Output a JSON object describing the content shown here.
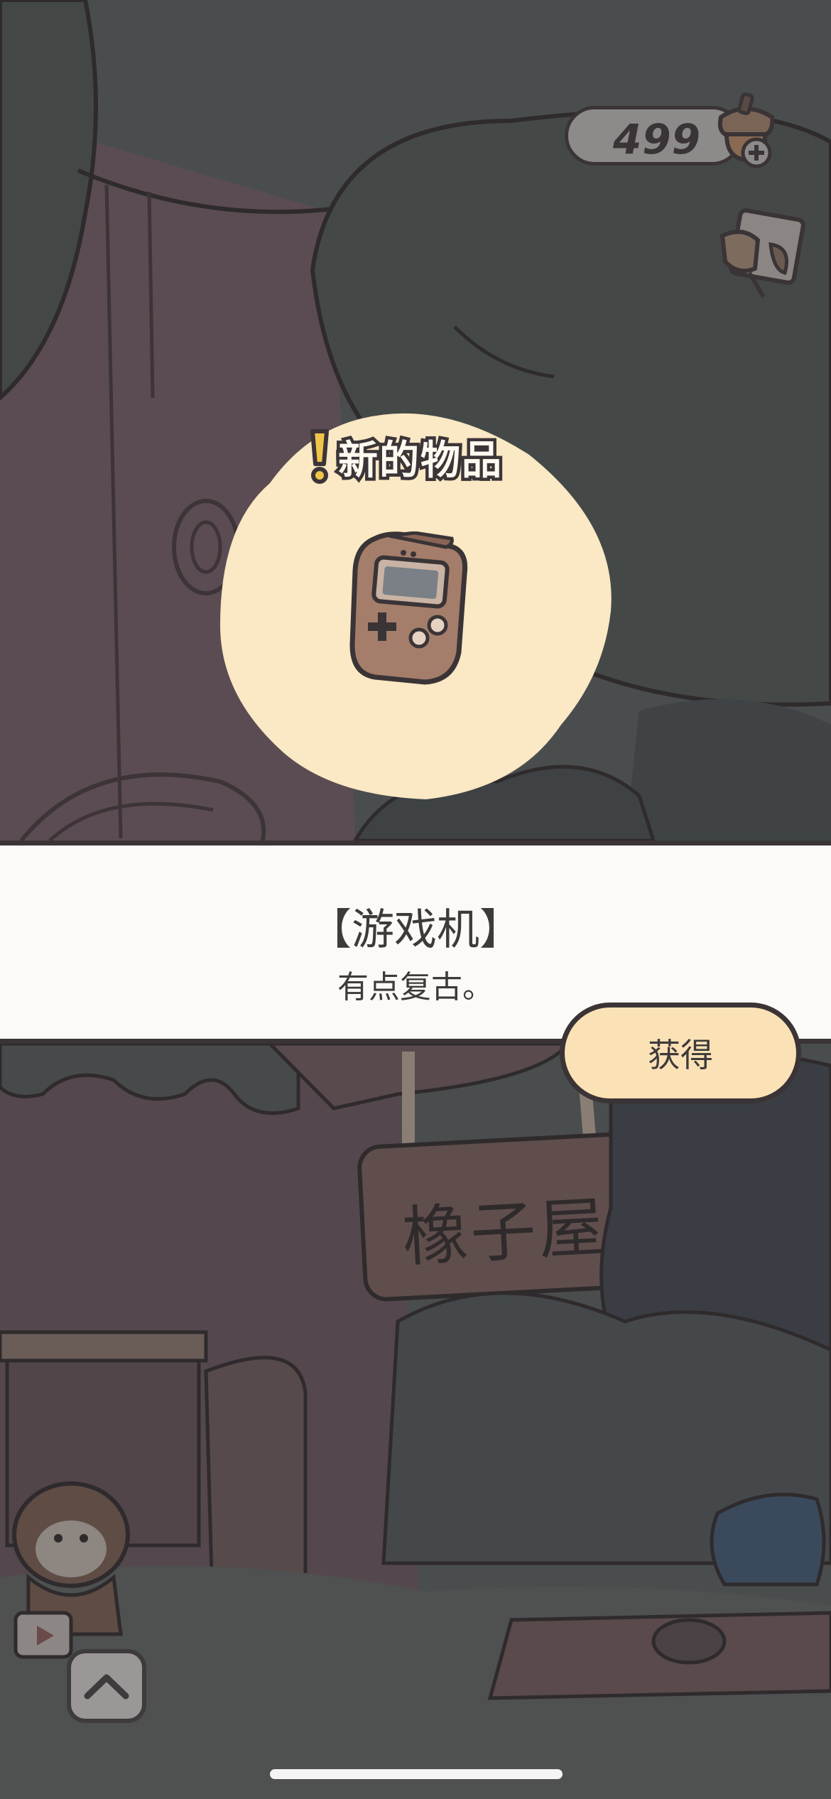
{
  "currency": {
    "amount": "499",
    "icon": "acorn-icon",
    "add_icon": "plus-icon"
  },
  "top_right_button": {
    "icon": "note-icon"
  },
  "new_item": {
    "alert_icon": "exclamation-icon",
    "label": "新的物品",
    "image_icon": "handheld-game-console-icon"
  },
  "item_banner": {
    "name": "【游戏机】",
    "description": "有点复古。"
  },
  "get_button": {
    "label": "获得"
  },
  "shop_sign": {
    "text": "橡子屋"
  },
  "bottom_nav": {
    "up_icon": "chevron-up-icon"
  },
  "colors": {
    "overlay_dark": "#4a4d4d",
    "banner_bg": "#fbfaf6",
    "button_bg": "#fbe2b6",
    "blob_bg": "#fbe8c4",
    "outline": "#3a3436"
  }
}
